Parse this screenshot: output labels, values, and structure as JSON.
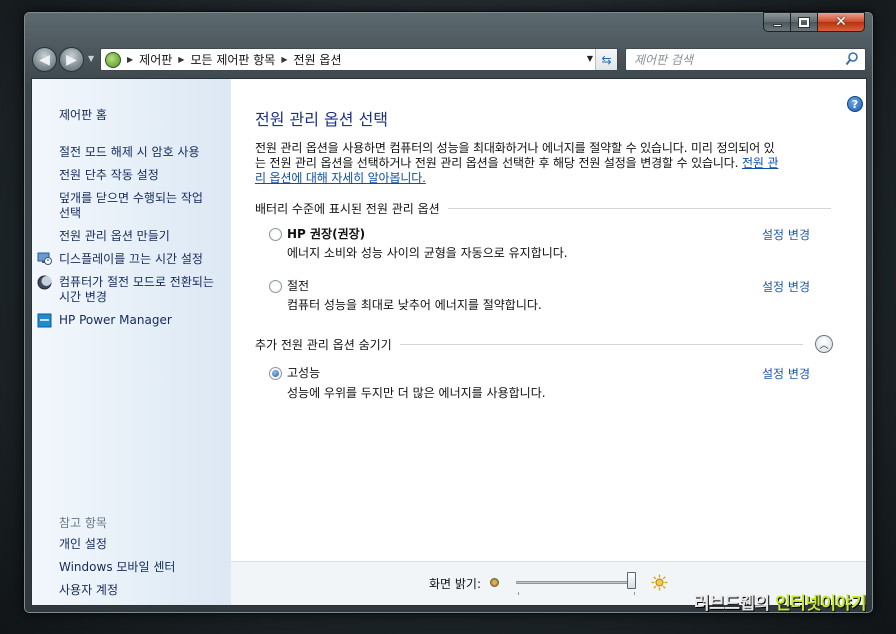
{
  "address_bar": {
    "crumbs": [
      "제어판",
      "모든 제어판 항목",
      "전원 옵션"
    ]
  },
  "search": {
    "placeholder": "제어판 검색"
  },
  "sidebar": {
    "home": "제어판 홈",
    "links": [
      {
        "label": "절전 모드 해제 시 암호 사용"
      },
      {
        "label": "전원 단추 작동 설정"
      },
      {
        "label_line1": "덮개를 닫으면 수행되는 작업",
        "label_line2": "선택"
      },
      {
        "label": "전원 관리 옵션 만들기"
      },
      {
        "label": "디스플레이를 끄는 시간 설정",
        "icon": "monitor-clock-icon"
      },
      {
        "label_line1": "컴퓨터가 절전 모드로 전환되는",
        "label_line2": "시간 변경",
        "icon": "moon-icon"
      },
      {
        "label": "HP Power Manager",
        "icon": "hp-power-manager-icon"
      }
    ],
    "see_also_heading": "참고 항목",
    "see_also": [
      "개인 설정",
      "Windows 모바일 센터",
      "사용자 계정"
    ]
  },
  "main": {
    "title": "전원 관리 옵션 선택",
    "desc_line1": "전원 관리 옵션을 사용하면 컴퓨터의 성능을 최대화하거나 에너지를 절약할 수 있습니다. 미리 정의되어 있",
    "desc_line2_text": "는 전원 관리 옵션을 선택하거나 전원 관리 옵션을 선택한 후 해당 전원 설정을 변경할 수 있습니다. ",
    "desc_link_part1": "전원 관",
    "desc_link_part2": "리 옵션에 대해 자세히 알아봅니다.",
    "battery_group_title": "배터리 수준에 표시된 전원 관리 옵션",
    "more_group_title": "추가 전원 관리 옵션 숨기기",
    "change_settings_label": "설정 변경",
    "plans": [
      {
        "name": "HP 권장(권장)",
        "description": "에너지 소비와 성능 사이의 균형을 자동으로 유지합니다.",
        "selected": false
      },
      {
        "name": "절전",
        "description": "컴퓨터 성능을 최대로 낮추어 에너지를 절약합니다.",
        "selected": false
      },
      {
        "name": "고성능",
        "description": "성능에 우위를 두지만 더 많은 에너지를 사용합니다.",
        "selected": true
      }
    ]
  },
  "bottom": {
    "brightness_label": "화면 밝기:",
    "brightness_level": 1.0
  },
  "watermark": {
    "part1": "러브드웹의 ",
    "part2": "인터넷이야기"
  },
  "colors": {
    "link": "#1e5aa8",
    "title": "#1e3287",
    "sidebar_text": "#152a5c"
  }
}
